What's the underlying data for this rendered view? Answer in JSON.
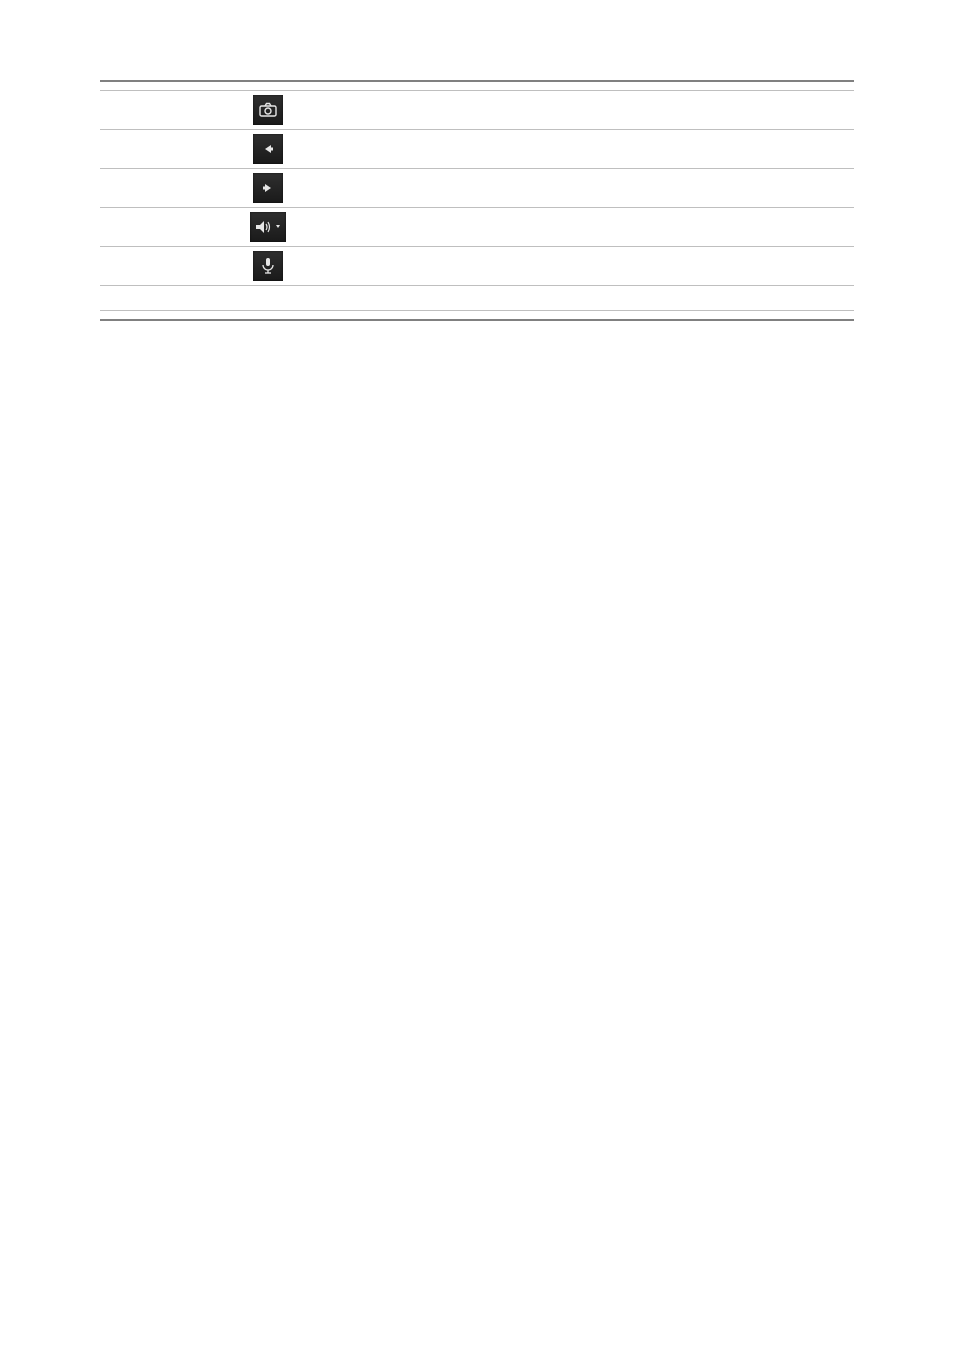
{
  "table": {
    "rows": [
      {
        "index": "",
        "icon": "camera-icon",
        "description": ""
      },
      {
        "index": "",
        "icon": "arrow-left-icon",
        "description": ""
      },
      {
        "index": "",
        "icon": "arrow-right-icon",
        "description": ""
      },
      {
        "index": "",
        "icon": "speaker-icon",
        "description": ""
      },
      {
        "index": "",
        "icon": "microphone-icon",
        "description": ""
      }
    ]
  }
}
